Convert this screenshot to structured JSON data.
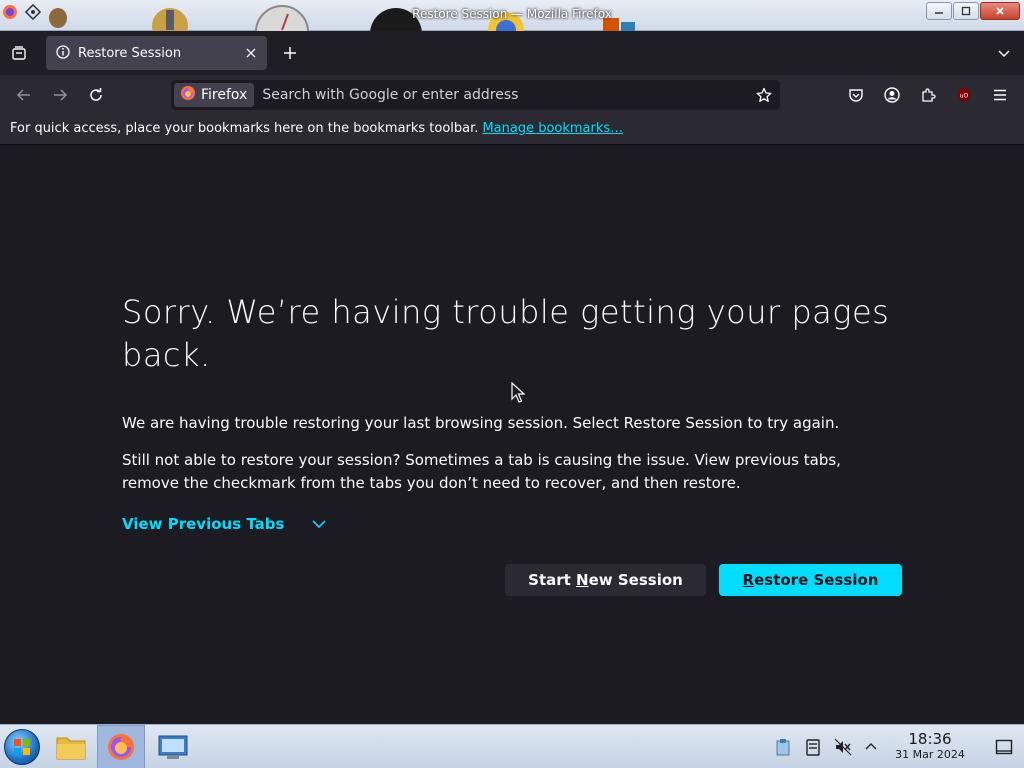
{
  "window": {
    "title": "Restore Session — Mozilla Firefox"
  },
  "tabs": [
    {
      "label": "Restore Session",
      "icon": "info-icon",
      "active": true
    }
  ],
  "navbar": {
    "identity_label": "Firefox",
    "url_placeholder": "Search with Google or enter address",
    "url_value": ""
  },
  "bookmarks_toolbar": {
    "text": "For quick access, place your bookmarks here on the bookmarks toolbar.",
    "link_label": "Manage bookmarks…"
  },
  "content": {
    "heading": "Sorry. We’re having trouble getting your pages back.",
    "paragraph1": "We are having trouble restoring your last browsing session. Select Restore Session to try again.",
    "paragraph2": "Still not able to restore your session? Sometimes a tab is causing the issue. View previous tabs, remove the checkmark from the tabs you don’t need to recover, and then restore.",
    "view_previous_label": "View Previous Tabs",
    "start_new": {
      "before": "Start ",
      "accel": "N",
      "after": "ew Session"
    },
    "restore": {
      "before": "",
      "accel": "R",
      "after": "estore Session"
    }
  },
  "taskbar": {
    "time": "18:36",
    "date": "31 Mar 2024"
  },
  "colors": {
    "accent": "#00ddff",
    "content_bg": "#1c1b22",
    "toolbar_bg": "#2b2a33",
    "tab_bg": "#42414d"
  }
}
